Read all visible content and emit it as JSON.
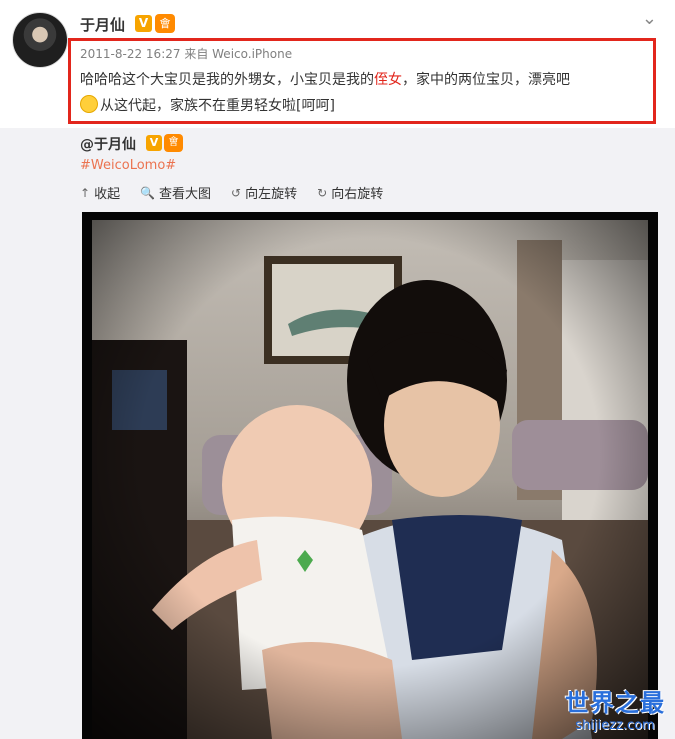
{
  "post": {
    "username": "于月仙",
    "verified_badge": "V",
    "vip_badge": "會",
    "timestamp": "2011-8-22 16:27",
    "source": "来自 Weico.iPhone",
    "text_part1": "哈哈哈这个大宝贝是我的外甥女，小宝贝是我的",
    "text_red": "侄女",
    "text_part2": "，家中的两位宝贝，漂亮吧",
    "text_part3": "从这代起，家族不在重男轻女啦[呵呵]",
    "menu_icon": "chevron-down-icon"
  },
  "repost": {
    "username": "@于月仙",
    "verified_badge": "V",
    "vip_badge": "會",
    "hashtag": "#WeicoLomo#",
    "toolbar": [
      {
        "icon": "↑",
        "label": "收起"
      },
      {
        "icon": "🔍",
        "label": "查看大图"
      },
      {
        "icon": "↺",
        "label": "向左旋转"
      },
      {
        "icon": "↻",
        "label": "向右旋转"
      }
    ]
  },
  "watermark": {
    "line1": "世界之最",
    "line2": "shijiezz.com"
  },
  "colors": {
    "highlight_border": "#e2261c",
    "hashtag": "#eb7350",
    "watermark": "#2a6fdb"
  }
}
